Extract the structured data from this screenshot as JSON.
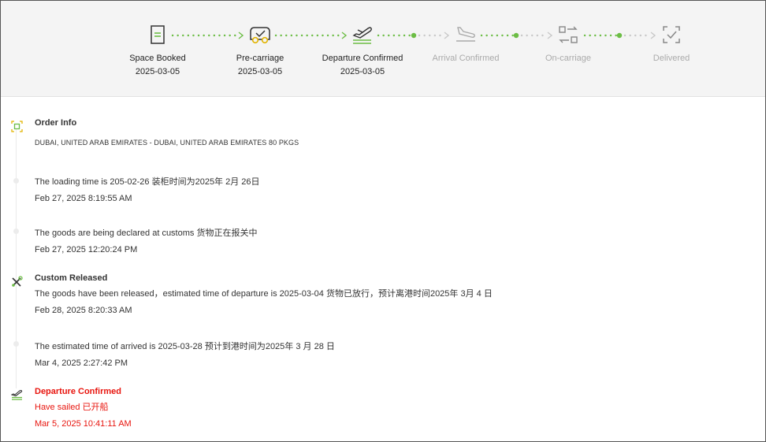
{
  "steps": [
    {
      "label": "Space Booked",
      "date": "2025-03-05",
      "icon": "document-icon",
      "done": true
    },
    {
      "label": "Pre-carriage",
      "date": "2025-03-05",
      "icon": "truck-check-icon",
      "done": true
    },
    {
      "label": "Departure Confirmed",
      "date": "2025-03-05",
      "icon": "plane-departure-icon",
      "done": true
    },
    {
      "label": "Arrival Confirmed",
      "date": "",
      "icon": "plane-arrival-icon",
      "done": false
    },
    {
      "label": "On-carriage",
      "date": "",
      "icon": "transfer-icon",
      "done": false
    },
    {
      "label": "Delivered",
      "date": "",
      "icon": "delivered-check-icon",
      "done": false
    }
  ],
  "events": [
    {
      "title": "Order Info",
      "text": "DUBAI, UNITED ARAB EMIRATES - DUBAI, UNITED ARAB EMIRATES 80 PKGS",
      "time": ""
    },
    {
      "title": "",
      "text": "The loading time is 205-02-26 装柜时间为2025年 2月 26日",
      "time": "Feb 27, 2025 8:19:55 AM"
    },
    {
      "title": "",
      "text": "The goods are being declared at customs 货物正在报关中",
      "time": "Feb 27, 2025 12:20:24 PM"
    },
    {
      "title": "Custom Released",
      "text": "The goods have been released，estimated time of departure is 2025-03-04 货物已放行，预计离港时间2025年 3月 4 日",
      "time": "Feb 28, 2025 8:20:33 AM"
    },
    {
      "title": "",
      "text": "The estimated time of arrived is 2025-03-28 预计到港时间为2025年 3 月 28 日",
      "time": "Mar 4, 2025 2:27:42 PM"
    },
    {
      "title": "Departure Confirmed",
      "text": "Have sailed 已开船",
      "time": "Mar 5, 2025 10:41:11 AM"
    }
  ],
  "colors": {
    "done": "#6cbd45",
    "pending": "#c8c8c8",
    "active": "#e8150e",
    "bg": "#f4f4f4"
  }
}
